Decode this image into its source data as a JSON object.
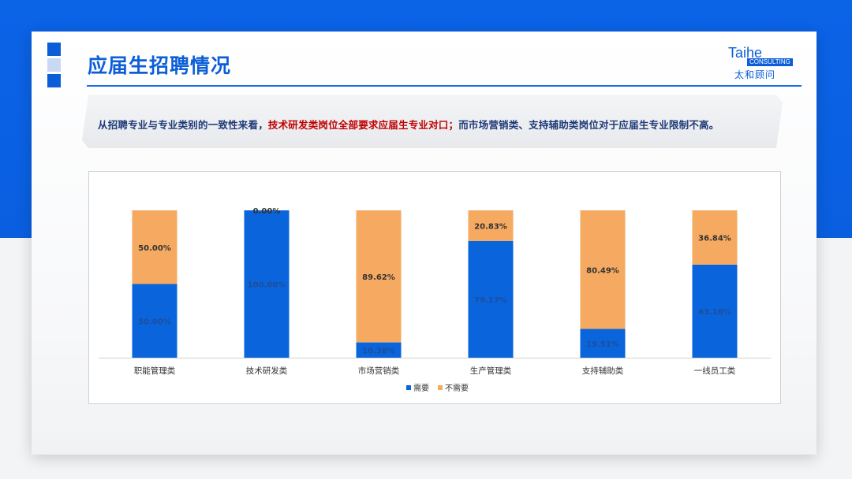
{
  "header": {
    "title": "应届生招聘情况",
    "logo_main": "Taihe",
    "logo_sub": "CONSULTING",
    "logo_cn": "太和顾问"
  },
  "banner": {
    "part1": "从招聘专业与专业类别的一致性来看，",
    "part2": "技术研发类岗位全部要求应届生专业对口；",
    "part3": "而市场营销类、支持辅助类岗位对于应届生专业限制不高。"
  },
  "colors": {
    "accent": "#0b5ed7",
    "series_need": "#0a64dc",
    "series_noneed": "#f5a961",
    "highlight_red": "#c00000",
    "highlight_blue": "#1f3a78"
  },
  "chart_data": {
    "type": "bar",
    "stacked": true,
    "categories": [
      "职能管理类",
      "技术研发类",
      "市场营销类",
      "生产管理类",
      "支持辅助类",
      "一线员工类"
    ],
    "series": [
      {
        "name": "需要",
        "values": [
          50.0,
          100.0,
          10.38,
          79.17,
          19.51,
          63.16
        ],
        "labels": [
          "50.00%",
          "100.00%",
          "10.38%",
          "79.17%",
          "19.51%",
          "63.16%"
        ]
      },
      {
        "name": "不需要",
        "values": [
          50.0,
          0.0,
          89.62,
          20.83,
          80.49,
          36.84
        ],
        "labels": [
          "50.00%",
          "0.00%",
          "89.62%",
          "20.83%",
          "80.49%",
          "36.84%"
        ]
      }
    ],
    "ylim": [
      0,
      100
    ],
    "grid": false,
    "legend": "bottom"
  }
}
